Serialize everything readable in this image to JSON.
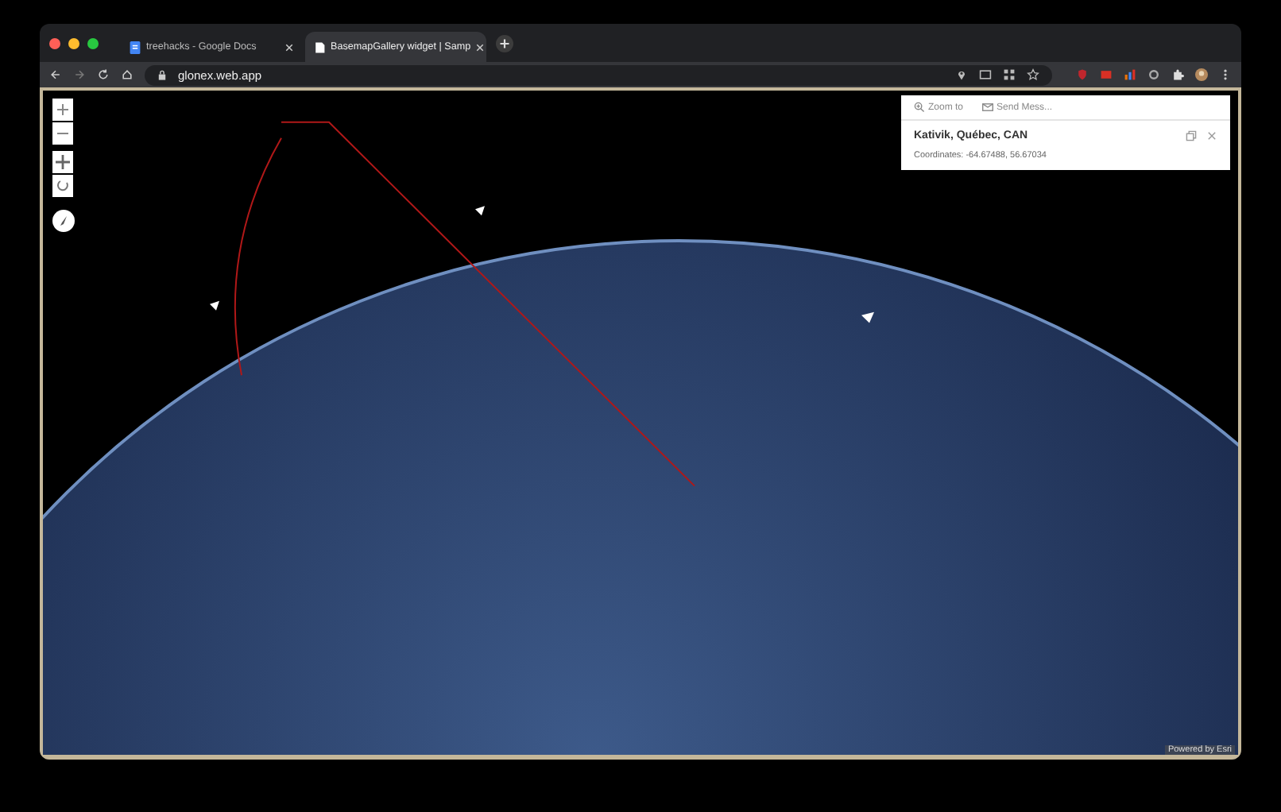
{
  "browser": {
    "tabs": [
      {
        "title": "treehacks - Google Docs",
        "selected": false,
        "kind": "docs"
      },
      {
        "title": "BasemapGallery widget | Samp",
        "selected": true,
        "kind": "page"
      }
    ],
    "address": "glonex.web.app"
  },
  "popup": {
    "actions": [
      {
        "label": "Zoom to",
        "kind": "zoom"
      },
      {
        "label": "Send Mess...",
        "kind": "mail"
      }
    ],
    "title": "Kativik, Québec, CAN",
    "text": "Coordinates: -64.67488, 56.67034"
  },
  "attribution": "Powered by Esri"
}
